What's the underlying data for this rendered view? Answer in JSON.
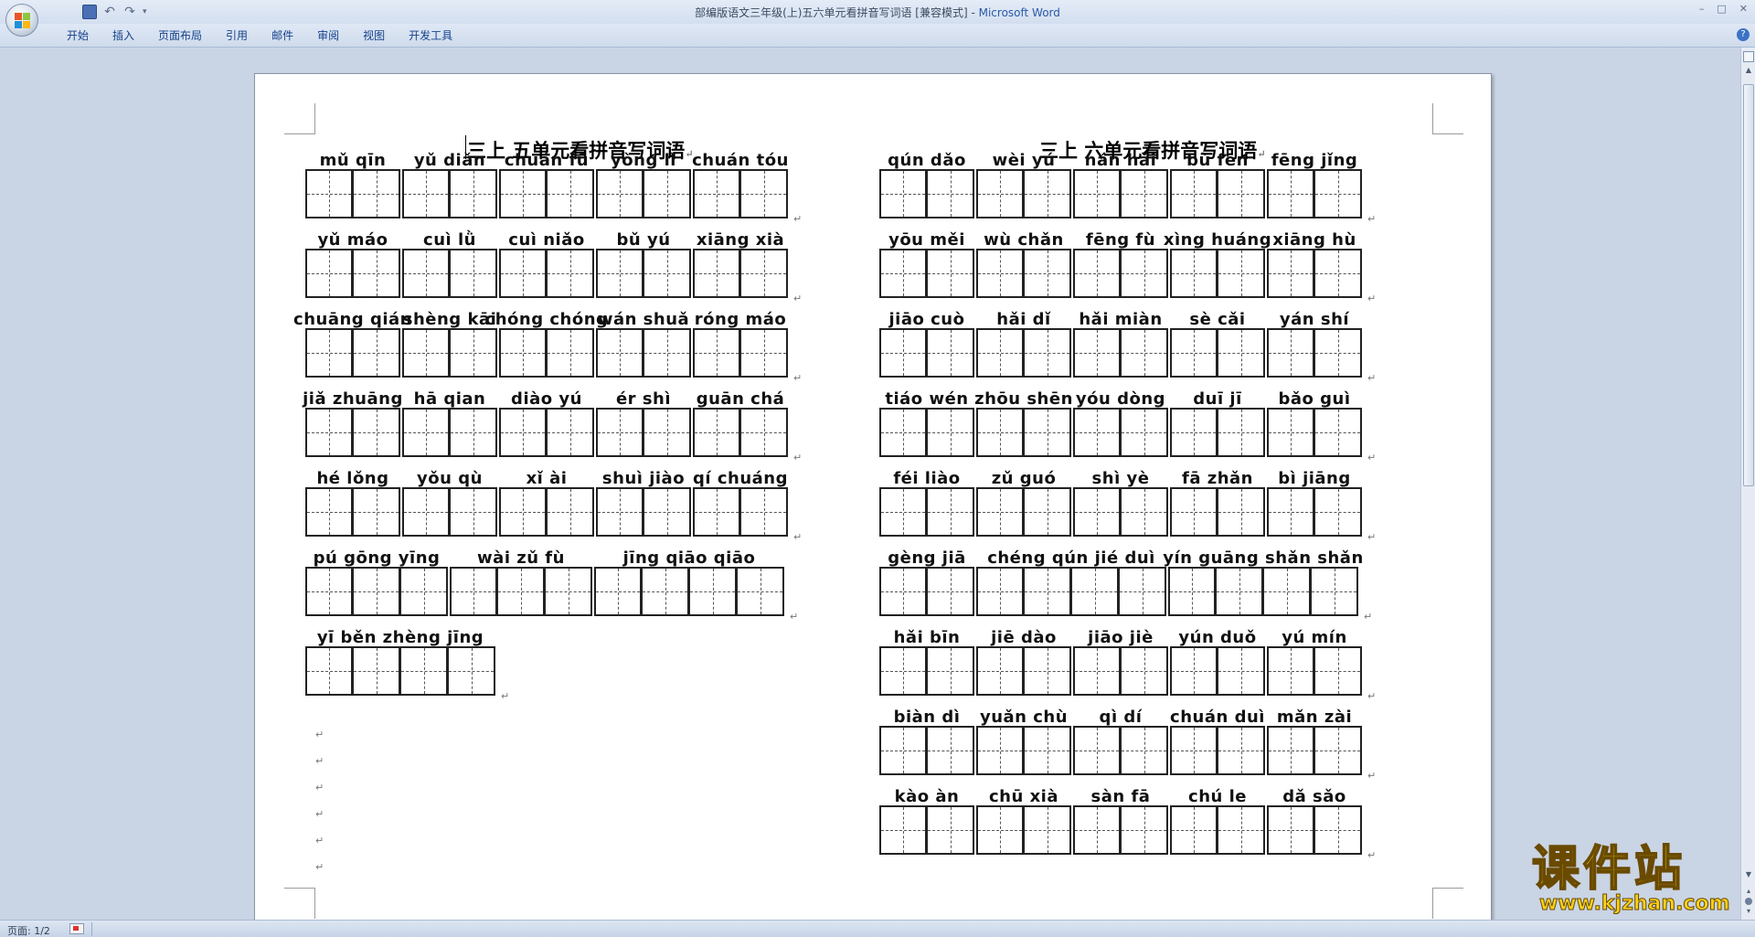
{
  "window": {
    "title": "部编版语文三年级(上)五六单元看拼音写词语 [兼容模式] - ",
    "app_name": "Microsoft Word",
    "controls": [
      "–",
      "□",
      "✕"
    ]
  },
  "quick_access": {
    "undo_glyph": "↶",
    "redo_glyph": "↷",
    "more_glyph": "▾"
  },
  "ribbon": {
    "tabs": [
      "开始",
      "插入",
      "页面布局",
      "引用",
      "邮件",
      "审阅",
      "视图",
      "开发工具"
    ],
    "help_glyph": "?"
  },
  "document": {
    "left": {
      "title": "三上  五单元看拼音写词语",
      "rows": [
        {
          "words": [
            {
              "py": "mǔ  qīn",
              "n": 2
            },
            {
              "py": "yǔ  diǎn",
              "n": 2
            },
            {
              "py": "chuán fū",
              "n": 2
            },
            {
              "py": "yòng lì",
              "n": 2
            },
            {
              "py": "chuán tóu",
              "n": 2
            }
          ]
        },
        {
          "words": [
            {
              "py": "yǔ  máo",
              "n": 2
            },
            {
              "py": "cuì  lǜ",
              "n": 2
            },
            {
              "py": "cuì  niǎo",
              "n": 2
            },
            {
              "py": "bǔ  yú",
              "n": 2
            },
            {
              "py": "xiāng xià",
              "n": 2
            }
          ]
        },
        {
          "words": [
            {
              "py": "chuāng qián",
              "n": 2
            },
            {
              "py": "shèng kāi",
              "n": 2
            },
            {
              "py": "chóng chóng",
              "n": 2
            },
            {
              "py": "wán shuǎ",
              "n": 2
            },
            {
              "py": "róng máo",
              "n": 2
            }
          ]
        },
        {
          "words": [
            {
              "py": "jiǎ  zhuāng",
              "n": 2
            },
            {
              "py": "hā  qian",
              "n": 2
            },
            {
              "py": "diào yú",
              "n": 2
            },
            {
              "py": "ér shì",
              "n": 2
            },
            {
              "py": "guān chá",
              "n": 2
            }
          ]
        },
        {
          "words": [
            {
              "py": "hé  lǒng",
              "n": 2
            },
            {
              "py": "yǒu qù",
              "n": 2
            },
            {
              "py": "xǐ  ài",
              "n": 2
            },
            {
              "py": "shuì  jiào",
              "n": 2
            },
            {
              "py": "qí  chuáng",
              "n": 2
            }
          ]
        },
        {
          "words": [
            {
              "py": "pú  gōng yīng",
              "n": 3
            },
            {
              "py": "wài zǔ  fù",
              "n": 3
            },
            {
              "py": "jīng qiāo qiāo",
              "n": 4
            }
          ]
        },
        {
          "words": [
            {
              "py": "yī  běn zhèng jīng",
              "n": 4
            }
          ]
        }
      ]
    },
    "right": {
      "title": "三上  六单元看拼音写词语",
      "rows": [
        {
          "words": [
            {
              "py": "qún dǎo",
              "n": 2
            },
            {
              "py": "wèi yú",
              "n": 2
            },
            {
              "py": "nán hǎi",
              "n": 2
            },
            {
              "py": "bù  fen",
              "n": 2
            },
            {
              "py": "fēng jǐng",
              "n": 2
            }
          ]
        },
        {
          "words": [
            {
              "py": "yōu měi",
              "n": 2
            },
            {
              "py": "wù  chǎn",
              "n": 2
            },
            {
              "py": "fēng fù",
              "n": 2
            },
            {
              "py": "xìng huáng",
              "n": 2
            },
            {
              "py": "xiāng hù",
              "n": 2
            }
          ]
        },
        {
          "words": [
            {
              "py": "jiāo cuò",
              "n": 2
            },
            {
              "py": "hǎi dǐ",
              "n": 2
            },
            {
              "py": "hǎi miàn",
              "n": 2
            },
            {
              "py": "sè  cǎi",
              "n": 2
            },
            {
              "py": "yán shí",
              "n": 2
            }
          ]
        },
        {
          "words": [
            {
              "py": "tiáo wén",
              "n": 2
            },
            {
              "py": "zhōu shēn",
              "n": 2
            },
            {
              "py": "yóu dòng",
              "n": 2
            },
            {
              "py": "duī  jī",
              "n": 2
            },
            {
              "py": "bǎo guì",
              "n": 2
            }
          ]
        },
        {
          "words": [
            {
              "py": "féi liào",
              "n": 2
            },
            {
              "py": "zǔ  guó",
              "n": 2
            },
            {
              "py": "shì  yè",
              "n": 2
            },
            {
              "py": "fā  zhǎn",
              "n": 2
            },
            {
              "py": "bì  jiāng",
              "n": 2
            }
          ]
        },
        {
          "words": [
            {
              "py": "gèng jiā",
              "n": 2
            },
            {
              "py": "chéng qún jié  duì",
              "n": 4
            },
            {
              "py": "yín guāng shǎn shǎn",
              "n": 4
            }
          ]
        },
        {
          "words": [
            {
              "py": "hǎi bīn",
              "n": 2
            },
            {
              "py": "jiē  dào",
              "n": 2
            },
            {
              "py": "jiāo jiè",
              "n": 2
            },
            {
              "py": "yún duǒ",
              "n": 2
            },
            {
              "py": "yú  mín",
              "n": 2
            }
          ]
        },
        {
          "words": [
            {
              "py": "biàn dì",
              "n": 2
            },
            {
              "py": "yuǎn chù",
              "n": 2
            },
            {
              "py": "qì  dí",
              "n": 2
            },
            {
              "py": "chuán duì",
              "n": 2
            },
            {
              "py": "mǎn zài",
              "n": 2
            }
          ]
        },
        {
          "words": [
            {
              "py": "kào àn",
              "n": 2
            },
            {
              "py": "chū  xià",
              "n": 2
            },
            {
              "py": "sàn fā",
              "n": 2
            },
            {
              "py": "chú  le",
              "n": 2
            },
            {
              "py": "dǎ  sǎo",
              "n": 2
            }
          ]
        }
      ]
    },
    "paragraph_mark": "↵"
  },
  "scrollbar": {
    "up_glyph": "▲",
    "down_glyph": "▼",
    "prev_glyph": "▴",
    "next_glyph": "▾"
  },
  "status": {
    "page_label": "页面: 1/2"
  },
  "watermark": {
    "cn": "课件站",
    "url": "www.kjzhan.com"
  }
}
